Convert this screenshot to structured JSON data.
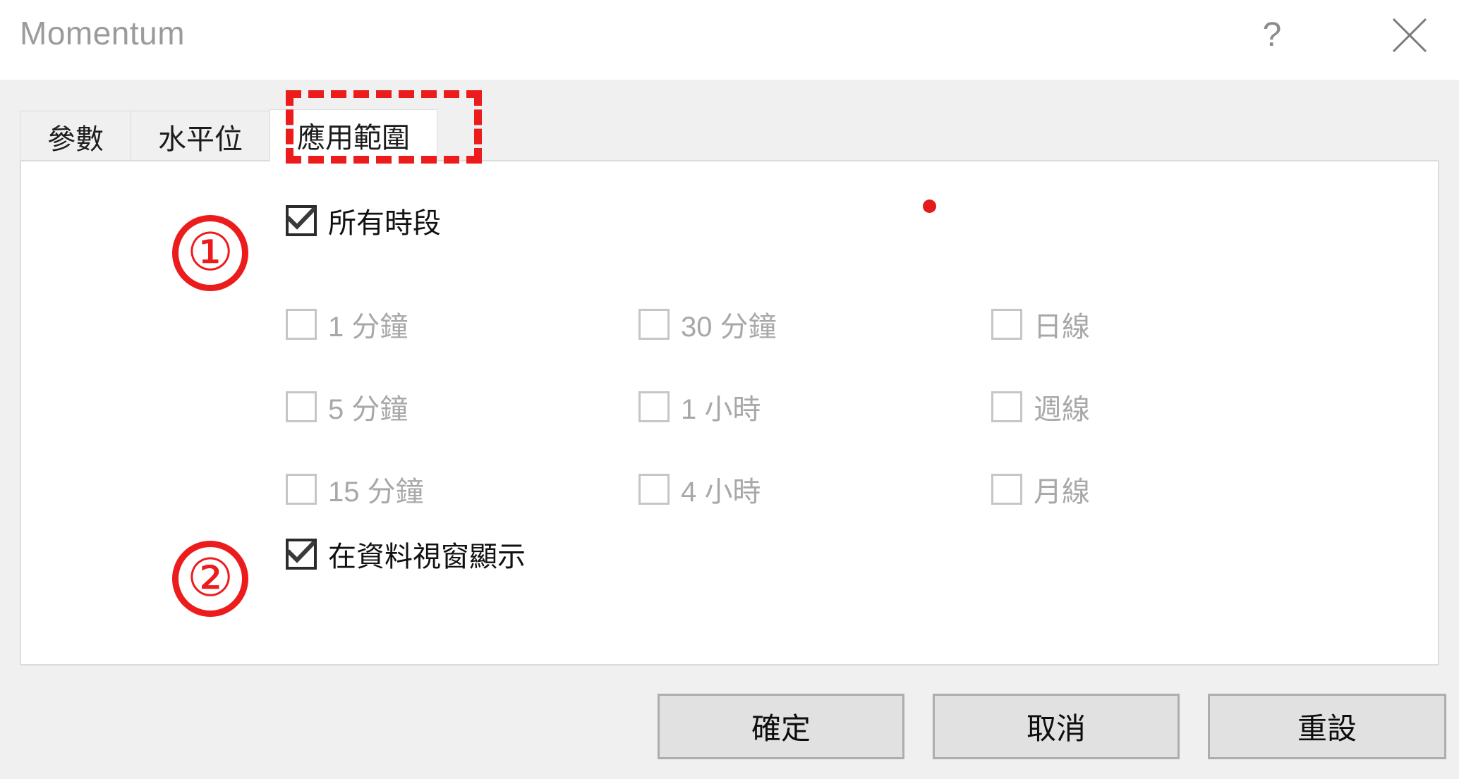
{
  "window": {
    "title": "Momentum",
    "help_glyph": "?",
    "help_name": "help-button",
    "close_name": "close-button"
  },
  "tabs": [
    {
      "label": "參數",
      "active": false
    },
    {
      "label": "水平位",
      "active": false
    },
    {
      "label": "應用範圍",
      "active": true
    }
  ],
  "panel": {
    "all_timeframes": {
      "label": "所有時段",
      "checked": true,
      "enabled": true
    },
    "timeframes": [
      [
        {
          "label": "1 分鐘",
          "checked": false,
          "enabled": false
        },
        {
          "label": "30 分鐘",
          "checked": false,
          "enabled": false
        },
        {
          "label": "日線",
          "checked": false,
          "enabled": false
        }
      ],
      [
        {
          "label": "5 分鐘",
          "checked": false,
          "enabled": false
        },
        {
          "label": "1 小時",
          "checked": false,
          "enabled": false
        },
        {
          "label": "週線",
          "checked": false,
          "enabled": false
        }
      ],
      [
        {
          "label": "15 分鐘",
          "checked": false,
          "enabled": false
        },
        {
          "label": "4 小時",
          "checked": false,
          "enabled": false
        },
        {
          "label": "月線",
          "checked": false,
          "enabled": false
        }
      ]
    ],
    "show_in_data_window": {
      "label": "在資料視窗顯示",
      "checked": true,
      "enabled": true
    }
  },
  "annotations": {
    "marker_1": "①",
    "marker_2": "②",
    "highlight_color": "#ed1c1c",
    "dot_color": "#e31b1b"
  },
  "footer": {
    "ok_label": "確定",
    "cancel_label": "取消",
    "reset_label": "重設"
  },
  "colors": {
    "titlebar_bg": "#ffffff",
    "dialog_bg": "#f0f0f0",
    "panel_bg": "#ffffff",
    "panel_border": "#dcdcdc",
    "title_text": "#9b9b9b",
    "enabled_text": "#1c1c1c",
    "disabled_text": "#a8a8a8",
    "button_bg": "#e1e1e1",
    "button_border": "#adadad"
  }
}
